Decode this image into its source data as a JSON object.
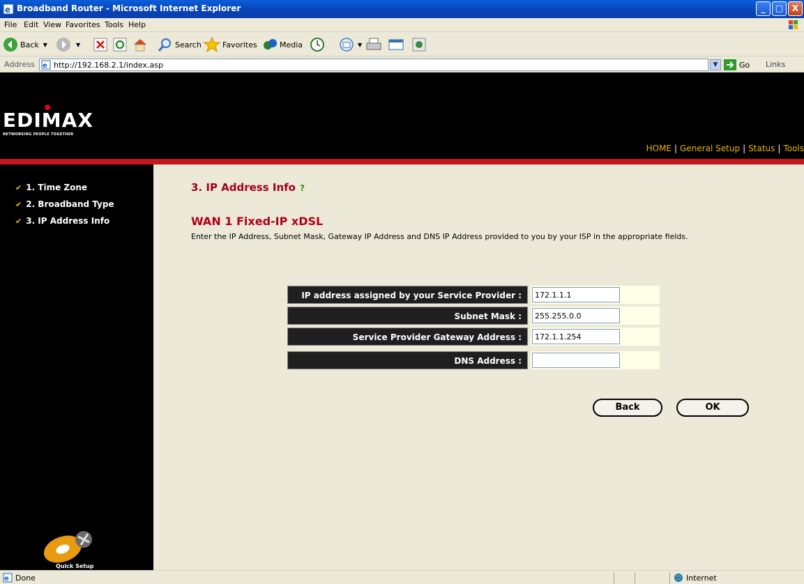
{
  "window": {
    "title": "Broadband Router - Microsoft Internet Explorer",
    "minimize": "_",
    "maximize": "□",
    "close": "X"
  },
  "menu": [
    "File",
    "Edit",
    "View",
    "Favorites",
    "Tools",
    "Help"
  ],
  "toolbar": {
    "back": "Back",
    "search": "Search",
    "favorites": "Favorites",
    "media": "Media"
  },
  "address": {
    "label": "Address",
    "url": "http://192.168.2.1/index.asp",
    "go": "Go",
    "links": "Links"
  },
  "header": {
    "logo": "EDIMAX",
    "tagline": "NETWORKING PEOPLE TOGETHER",
    "nav": [
      "HOME",
      "General Setup",
      "Status",
      "Tools"
    ]
  },
  "sidebar": {
    "items": [
      "1. Time Zone",
      "2. Broadband Type",
      "3. IP Address Info"
    ],
    "quick_setup": "Quick Setup"
  },
  "main": {
    "section_title": "3. IP Address Info",
    "sub_title": "WAN 1 Fixed-IP xDSL",
    "description": "Enter the IP Address, Subnet Mask, Gateway IP Address and DNS IP Address provided to you by your ISP in the appropriate fields.",
    "fields": [
      {
        "label": "IP address assigned by your Service Provider :",
        "value": "172.1.1.1"
      },
      {
        "label": "Subnet Mask :",
        "value": "255.255.0.0"
      },
      {
        "label": "Service Provider Gateway Address :",
        "value": "172.1.1.254"
      },
      {
        "label": "DNS Address :",
        "value": ""
      }
    ],
    "back_button": "Back",
    "ok_button": "OK"
  },
  "status": {
    "text": "Done",
    "zone": "Internet"
  }
}
